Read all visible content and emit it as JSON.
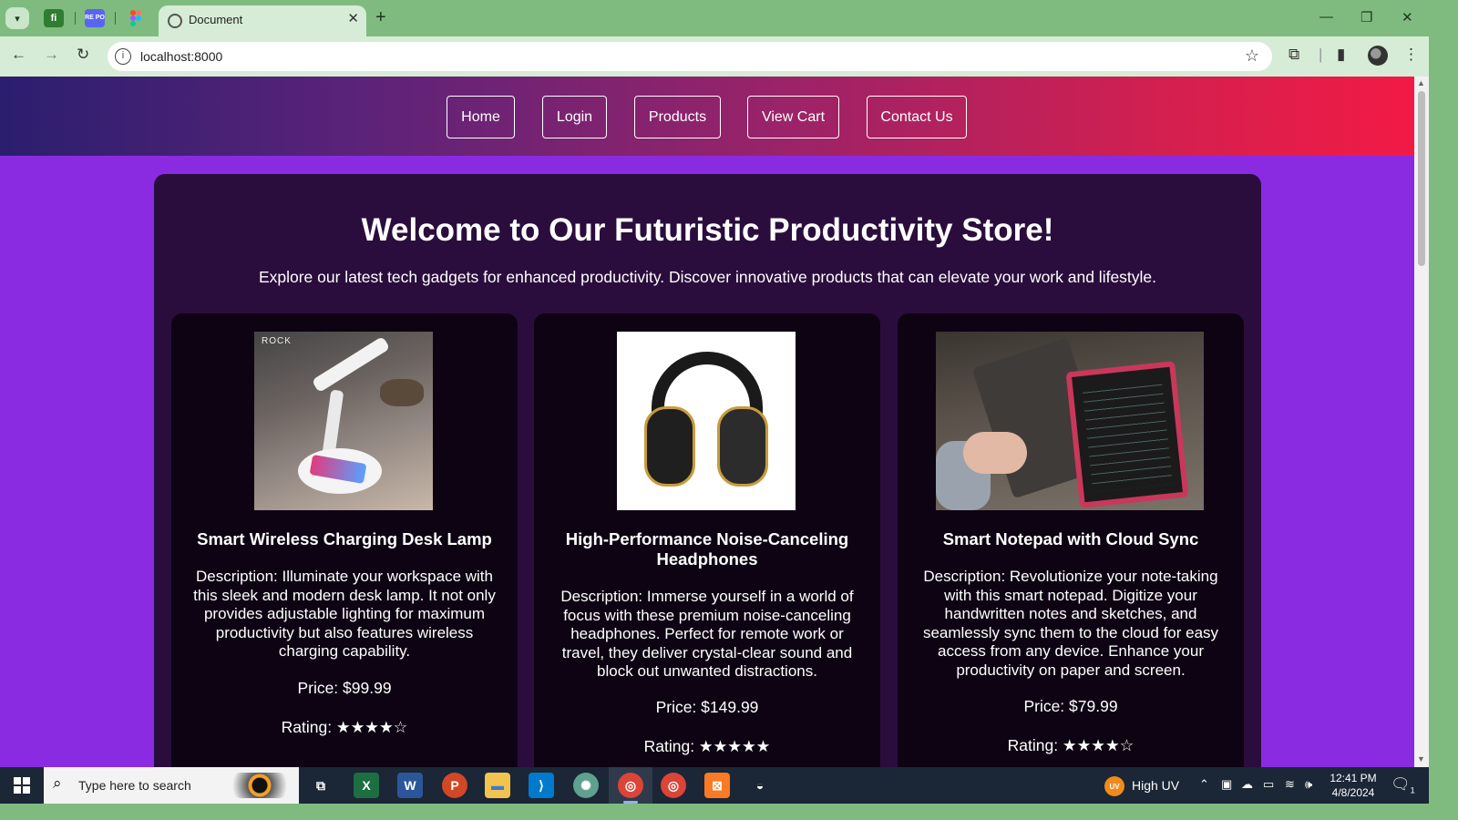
{
  "browser": {
    "pinned_tabs": [
      {
        "icon": "fi",
        "color": "#2e7d32"
      },
      {
        "icon": "RE PO",
        "color": "#5865f2"
      },
      {
        "icon": "figma",
        "color": "#e24a2f"
      }
    ],
    "active_tab_title": "Document",
    "url": "localhost:8000"
  },
  "site": {
    "nav": [
      "Home",
      "Login",
      "Products",
      "View Cart",
      "Contact Us"
    ],
    "title": "Welcome to Our Futuristic Productivity Store!",
    "intro": "Explore our latest tech gadgets for enhanced productivity. Discover innovative products that can elevate your work and lifestyle.",
    "products": [
      {
        "name": "Smart Wireless Charging Desk Lamp",
        "description": "Description: Illuminate your workspace with this sleek and modern desk lamp. It not only provides adjustable lighting for maximum productivity but also features wireless charging capability.",
        "price": "Price: $99.99",
        "rating": "Rating: ★★★★☆",
        "image_brand": "ROCK"
      },
      {
        "name": "High-Performance Noise-Canceling Headphones",
        "description": "Description: Immerse yourself in a world of focus with these premium noise-canceling headphones. Perfect for remote work or travel, they deliver crystal-clear sound and block out unwanted distractions.",
        "price": "Price: $149.99",
        "rating": "Rating: ★★★★★"
      },
      {
        "name": "Smart Notepad with Cloud Sync",
        "description": "Description: Revolutionize your note-taking with this smart notepad. Digitize your handwritten notes and sketches, and seamlessly sync them to the cloud for easy access from any device. Enhance your productivity on paper and screen.",
        "price": "Price: $79.99",
        "rating": "Rating: ★★★★☆"
      }
    ]
  },
  "taskbar": {
    "search_placeholder": "Type here to search",
    "apps": [
      {
        "name": "task-view",
        "label": "⧉",
        "color": "#1b2636"
      },
      {
        "name": "excel",
        "label": "X",
        "color": "#1d6f42"
      },
      {
        "name": "word",
        "label": "W",
        "color": "#2b579a"
      },
      {
        "name": "powerpoint",
        "label": "P",
        "color": "#d24726"
      },
      {
        "name": "file-explorer",
        "label": "▬",
        "color": "#f2c34e"
      },
      {
        "name": "vscode",
        "label": "⟩",
        "color": "#007acc"
      },
      {
        "name": "chatgpt",
        "label": "✺",
        "color": "#5fa08e"
      },
      {
        "name": "chrome-active",
        "label": "◎",
        "color": "#db4437"
      },
      {
        "name": "chrome",
        "label": "◎",
        "color": "#db4437"
      },
      {
        "name": "xampp",
        "label": "⊠",
        "color": "#fb7a24"
      },
      {
        "name": "obs",
        "label": "◒",
        "color": "#1b2636"
      }
    ],
    "weather_label": "UV",
    "weather": "High UV",
    "time": "12:41 PM",
    "date": "4/8/2024",
    "notifications": "1"
  }
}
